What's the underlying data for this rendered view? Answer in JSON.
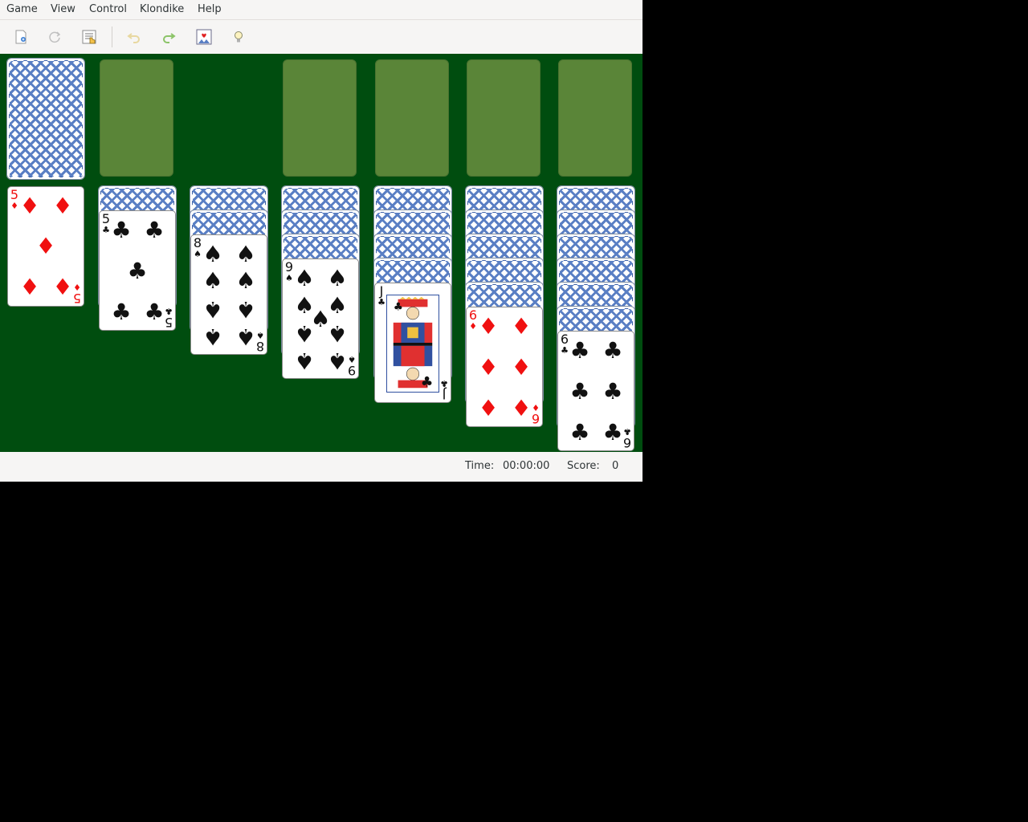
{
  "menu": [
    "Game",
    "View",
    "Control",
    "Klondike",
    "Help"
  ],
  "toolbar": {
    "icons": [
      "new-game-icon",
      "restart-icon",
      "select-game-icon",
      "undo-icon",
      "redo-icon",
      "deal-icon",
      "hint-icon"
    ]
  },
  "status": {
    "time_label": "Time:",
    "time_value": "00:00:00",
    "score_label": "Score:",
    "score_value": "0"
  },
  "board": {
    "stock": "face-down",
    "foundations": 4,
    "tableau": [
      {
        "face_down": 0,
        "face_up": {
          "rank": "5",
          "suit": "diamonds"
        }
      },
      {
        "face_down": 1,
        "face_up": {
          "rank": "5",
          "suit": "clubs"
        }
      },
      {
        "face_down": 2,
        "face_up": {
          "rank": "8",
          "suit": "spades"
        }
      },
      {
        "face_down": 3,
        "face_up": {
          "rank": "9",
          "suit": "spades"
        }
      },
      {
        "face_down": 4,
        "face_up": {
          "rank": "J",
          "suit": "clubs"
        }
      },
      {
        "face_down": 5,
        "face_up": {
          "rank": "6",
          "suit": "diamonds"
        }
      },
      {
        "face_down": 6,
        "face_up": {
          "rank": "6",
          "suit": "clubs"
        }
      }
    ]
  },
  "colors": {
    "felt": "#004d0f",
    "slot": "#5a8538",
    "card_back": "#3f62a8",
    "red_suit": "#f01010",
    "black_suit": "#111111"
  }
}
